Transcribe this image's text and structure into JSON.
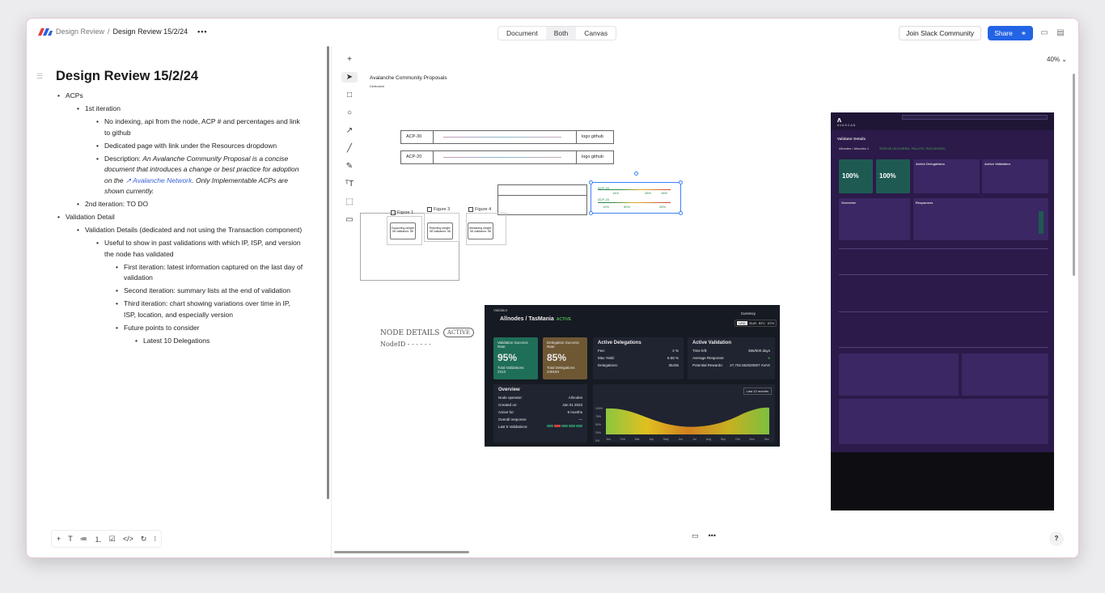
{
  "breadcrumb": {
    "parent": "Design Review",
    "separator": "/",
    "current": "Design Review 15/2/24",
    "more": "•••"
  },
  "view_modes": [
    "Document",
    "Both",
    "Canvas"
  ],
  "view_mode_selected": "Both",
  "topbar": {
    "slack": "Join Slack Community",
    "share": "Share"
  },
  "colors": {
    "accent": "#2264e5",
    "link": "#3a62d8",
    "active_status": "#4caf50"
  },
  "doc": {
    "title": "Design Review 15/2/24",
    "acps": "ACPs",
    "first_iteration": "1st iteration",
    "no_indexing": "No indexing, api from the node, ACP # and percentages and link to github",
    "dedicated": "Dedicated page with link under the Resources dropdown",
    "desc_label": "Description: ",
    "desc_italic": "An Avalanche Community Proposal is a concise document that introduces a change or best practice for adoption on the ",
    "desc_link": "Avalanche Network",
    "desc_tail": ". Only Implementable ACPs are shown currently.",
    "second_iteration": "2nd iteration: TO DO",
    "validation_detail": "Validation Detail",
    "validation_details": "Validation Details (dedicated and not using the Transaction component)",
    "useful": "Useful to show in past validations with which IP, ISP, and version the node has validated",
    "first_iter2": "First iteration: latest information captured on the last day of validation",
    "second_iter2": "Second iteration: summary lists at the end of validation",
    "third_iter2": "Third iteration: chart showing variations over time in IP, ISP, location, and especially version",
    "future": "Future points to consider",
    "latest10": "Latest 10 Delegations"
  },
  "canvas": {
    "zoom": "40%",
    "title": "Avalanche Community Proposals",
    "subtitle": "Dedicated",
    "acp_rows": [
      {
        "id": "ACP-30",
        "link": "logo github"
      },
      {
        "id": "ACP-20",
        "link": "logo github"
      }
    ],
    "acp_selected": [
      {
        "id": "ACP-20",
        "values": [
          "14%",
          "28%",
          "18%"
        ]
      },
      {
        "id": "ACP-20",
        "values": [
          "10%",
          "60%",
          "28%"
        ]
      }
    ],
    "figures": [
      "Figure 1",
      "Figure 3",
      "Figure 4"
    ],
    "fig_cards": [
      "Supporting weight: 58 validators: 58",
      "Rejecting weight: 58 validators: 58",
      "Abstaining weight: 58 validators: 58"
    ],
    "sketch": {
      "line1": "NODE DETAILS",
      "line2": "NodeID - - - - - -",
      "tag": "ACTIVE"
    }
  },
  "validator": {
    "header": "Validator",
    "name": "Allnodes / TasMania",
    "status": "ACTIVE",
    "currency_label": "Currency",
    "currencies": [
      "USD",
      "EUR",
      "BTC",
      "ETH"
    ],
    "success": {
      "label": "Validation Success Rate",
      "value": "95%",
      "sub_label": "Total Validations",
      "sub_value": "2313"
    },
    "delegation": {
      "label": "Delegation Success Rate",
      "value": "85%",
      "sub_label": "Total Delegations",
      "sub_value": "249194"
    },
    "active_delegations": {
      "title": "Active Delegations",
      "fee_label": "Fee:",
      "fee": "2 %",
      "max_label": "Max Yield:",
      "max": "6.58 %",
      "del_label": "Delegations:",
      "del": "35436"
    },
    "active_validation": {
      "title": "Active Validation",
      "time_label": "Time left:",
      "time": "365/500 days",
      "resp_label": "Average Response:",
      "pot_label": "Potential Rewards:",
      "pot": "27,702.562020807 AVAX"
    },
    "overview": {
      "title": "Overview",
      "op_label": "Node operator:",
      "op": "Allnodes",
      "created_label": "Created on:",
      "created": "Jan 01 2023",
      "active_label": "Active for:",
      "active": "9 months",
      "overall_label": "Overall response:",
      "last_label": "Last 5 Validations:"
    },
    "chart_filter": "Last 12 months",
    "chart_months": [
      "Jan",
      "Feb",
      "Mar",
      "Apr",
      "May",
      "Jun",
      "Jul",
      "Aug",
      "Sep",
      "Oct",
      "Nov",
      "Dec"
    ],
    "chart_ticks": [
      "100%",
      "75%",
      "50%",
      "25%",
      "0%"
    ]
  },
  "avascan": {
    "brand": "AVASCAN",
    "status_line": "STATUS (IN CORSO, FALLITO, SUCCESSO)",
    "validator_title": "Validator Details",
    "node": "Allnodes / Allnodes 1",
    "stat1": "100%",
    "stat2": "100%",
    "active_del": "Active Delegations",
    "active_val": "Active Validation",
    "overview": "Overview",
    "responses": "Responses"
  },
  "bottom_toolbar": [
    "+",
    "T",
    "≔",
    "⒈",
    "☑",
    "</>",
    "↻",
    "⁝"
  ],
  "help": "?"
}
